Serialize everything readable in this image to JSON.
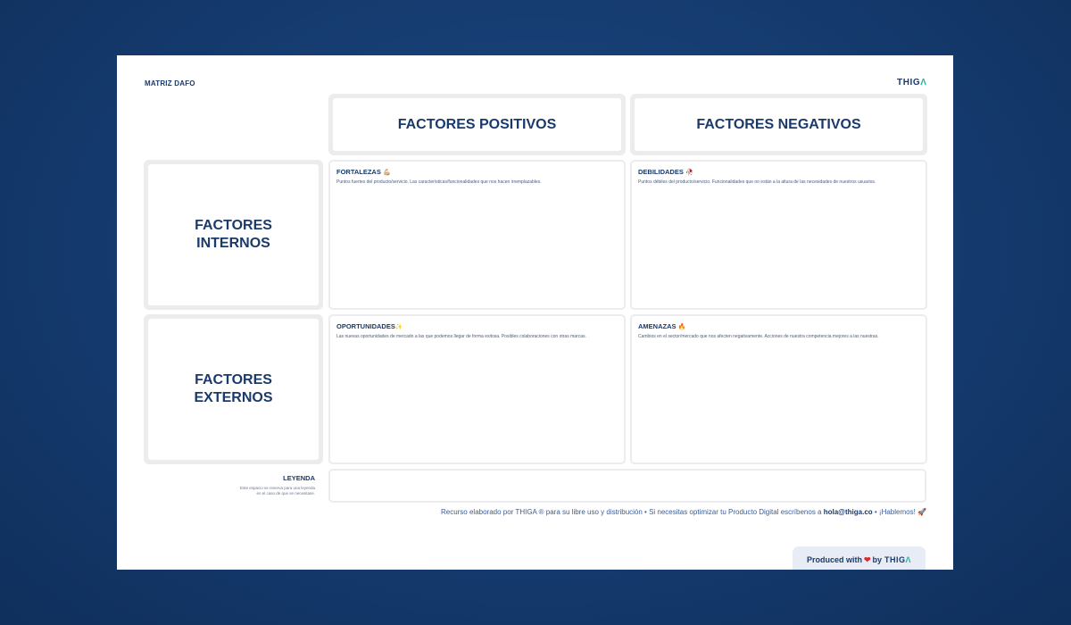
{
  "board": {
    "title": "MATRIZ DAFO",
    "logo_main": "THIG",
    "logo_accent": "Λ"
  },
  "headers": {
    "positive": "FACTORES POSITIVOS",
    "negative": "FACTORES NEGATIVOS"
  },
  "sides": {
    "internal_line1": "FACTORES",
    "internal_line2": "INTERNOS",
    "external_line1": "FACTORES",
    "external_line2": "EXTERNOS"
  },
  "quadrants": {
    "strengths": {
      "title": "FORTALEZAS",
      "emoji": "💪🏼",
      "desc": "Puntos fuertes del producto/servicio. Las características/funcionalidades que nos hacen irremplazables."
    },
    "weaknesses": {
      "title": "DEBILIDADES",
      "emoji": "🥀",
      "desc": "Puntos débiles del producto/servicio. Funcionalidades que no están a la altura de las necesidades de nuestros usuarios."
    },
    "opportunities": {
      "title": "OPORTUNIDADES",
      "emoji": "✨",
      "desc": "Las nuevas oportunidades de mercado a las que podemos llegar de forma exitosa. Posibles colaboraciones con otras marcas."
    },
    "threats": {
      "title": "AMENAZAS",
      "emoji": "🔥",
      "desc": "Cambios en el sector/mercado que nos afecten negativamente. Acciones de nuestra competencia mejores a las nuestras."
    }
  },
  "legend": {
    "title": "LEYENDA",
    "desc_line1": "Este espacio se reserva para una leyenda",
    "desc_line2": "en el caso de que se necesitase."
  },
  "footer": {
    "text_before": "Recurso elaborado por THIGA ® para su libre uso y distribución  •  Si necesitas optimizar tu Producto Digital escríbenos a ",
    "email": "hola@thiga.co",
    "text_after": "  •  ¡Hablemos! 🚀"
  },
  "badge": {
    "produced_with": "Produced with",
    "heart": "❤",
    "by": "by",
    "brand_main": "THIG",
    "brand_accent": "Λ"
  }
}
